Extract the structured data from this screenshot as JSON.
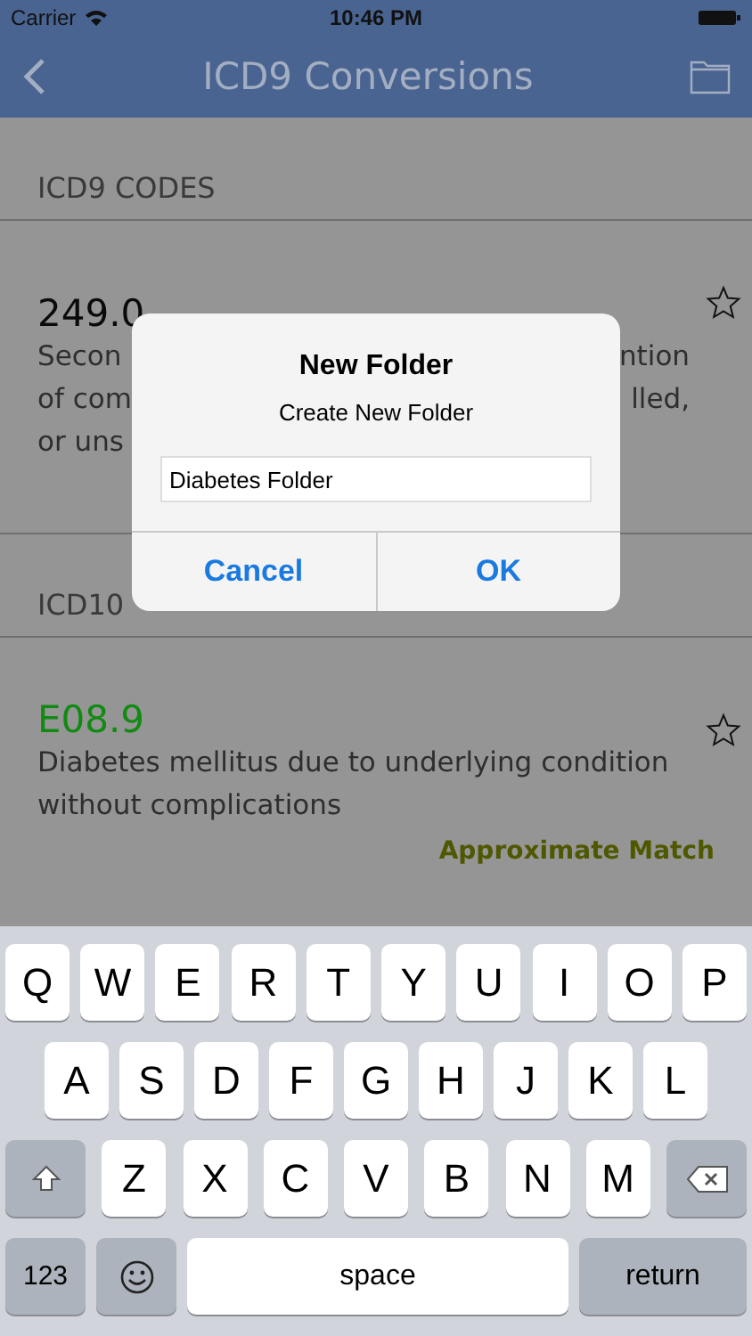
{
  "status_bar": {
    "carrier": "Carrier",
    "time": "10:46 PM"
  },
  "nav": {
    "title": "ICD9 Conversions"
  },
  "sections": [
    {
      "header": "ICD9 CODES",
      "code": "249.0",
      "color": "#0a0a0a",
      "lines": [
        {
          "left": "Secon",
          "right": "ntion"
        },
        {
          "left": "of com",
          "right": "lled,"
        },
        {
          "left": "or uns"
        }
      ],
      "starred": false
    },
    {
      "header": "ICD10",
      "code": "E08.9",
      "color": "#128a12",
      "lines": [
        {
          "left": "Diabetes mellitus due to underlying condition"
        },
        {
          "left": "without complications"
        }
      ],
      "starred": false,
      "note": "Approximate Match"
    }
  ],
  "dialog": {
    "title": "New Folder",
    "message": "Create New Folder",
    "field_value": "Diabetes Folder",
    "buttons": [
      {
        "label": "Cancel"
      },
      {
        "label": "OK"
      }
    ]
  },
  "keyboard": {
    "rows": [
      {
        "keys": [
          {
            "kind": "letter",
            "label": "Q"
          },
          {
            "kind": "letter",
            "label": "W"
          },
          {
            "kind": "letter",
            "label": "E"
          },
          {
            "kind": "letter",
            "label": "R"
          },
          {
            "kind": "letter",
            "label": "T"
          },
          {
            "kind": "letter",
            "label": "Y"
          },
          {
            "kind": "letter",
            "label": "U"
          },
          {
            "kind": "letter",
            "label": "I"
          },
          {
            "kind": "letter",
            "label": "O"
          },
          {
            "kind": "letter",
            "label": "P"
          }
        ]
      },
      {
        "keys": [
          {
            "kind": "letter",
            "label": "A"
          },
          {
            "kind": "letter",
            "label": "S"
          },
          {
            "kind": "letter",
            "label": "D"
          },
          {
            "kind": "letter",
            "label": "F"
          },
          {
            "kind": "letter",
            "label": "G"
          },
          {
            "kind": "letter",
            "label": "H"
          },
          {
            "kind": "letter",
            "label": "J"
          },
          {
            "kind": "letter",
            "label": "K"
          },
          {
            "kind": "letter",
            "label": "L"
          }
        ]
      },
      {
        "keys": [
          {
            "kind": "shift"
          },
          {
            "kind": "letter",
            "label": "Z"
          },
          {
            "kind": "letter",
            "label": "X"
          },
          {
            "kind": "letter",
            "label": "C"
          },
          {
            "kind": "letter",
            "label": "V"
          },
          {
            "kind": "letter",
            "label": "B"
          },
          {
            "kind": "letter",
            "label": "N"
          },
          {
            "kind": "letter",
            "label": "M"
          },
          {
            "kind": "delete"
          }
        ]
      },
      {
        "keys": [
          {
            "kind": "mode",
            "label": "123"
          },
          {
            "kind": "emoji"
          },
          {
            "kind": "space",
            "label": "space"
          },
          {
            "kind": "return",
            "label": "return"
          }
        ]
      }
    ]
  }
}
